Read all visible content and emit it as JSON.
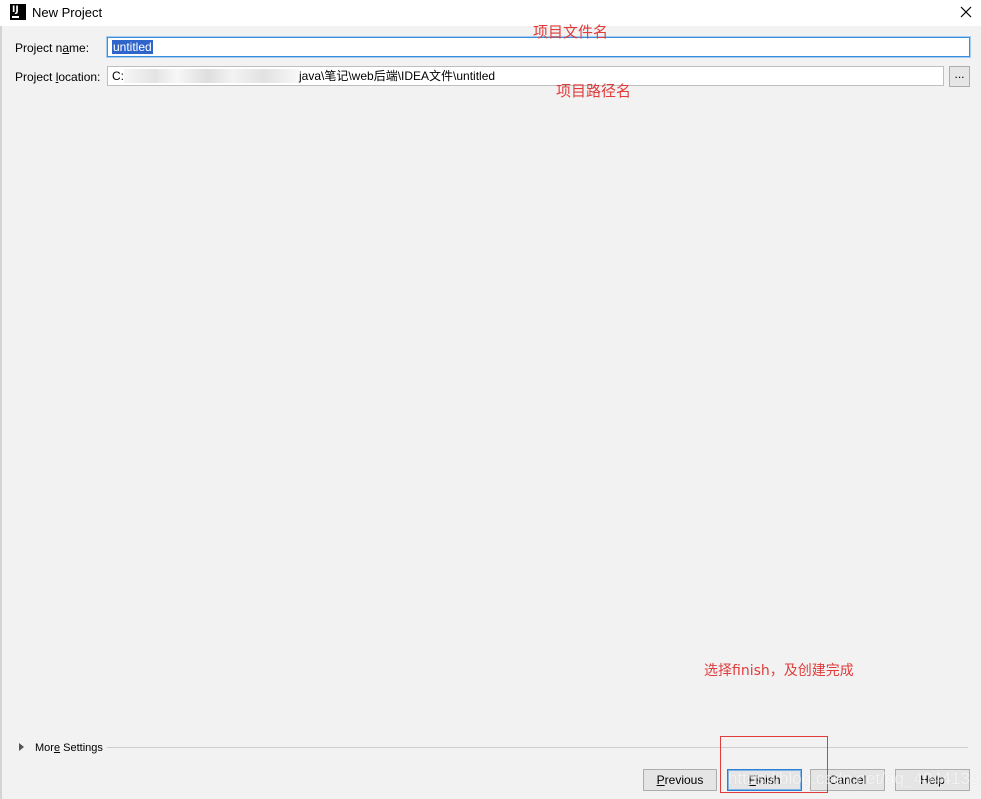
{
  "window": {
    "title": "New Project",
    "app_icon": "intellij-icon",
    "close_icon": "close-icon"
  },
  "form": {
    "name_label_pre": "Project n",
    "name_label_mnemonic": "a",
    "name_label_post": "me:",
    "name_value": "untitled",
    "location_label_pre": "Project ",
    "location_label_mnemonic": "l",
    "location_label_post": "ocation:",
    "location_prefix": "C:",
    "location_suffix": "java\\笔记\\web后端\\IDEA文件\\untitled",
    "browse_label": "..."
  },
  "annotations": {
    "name_note": "项目文件名",
    "location_note": "项目路径名",
    "finish_note": "选择finish，及创建完成",
    "accent_color": "#e03c3c"
  },
  "more_settings": {
    "label_pre": "Mor",
    "label_mnemonic": "e",
    "label_post": " Settings",
    "icon": "triangle-right-icon"
  },
  "buttons": {
    "previous_mnemonic": "P",
    "previous_rest": "revious",
    "finish_mnemonic": "F",
    "finish_rest": "inish",
    "cancel": "Cancel",
    "help": "Help"
  },
  "watermark": "https://blog.csdn.net/qq_40441390"
}
